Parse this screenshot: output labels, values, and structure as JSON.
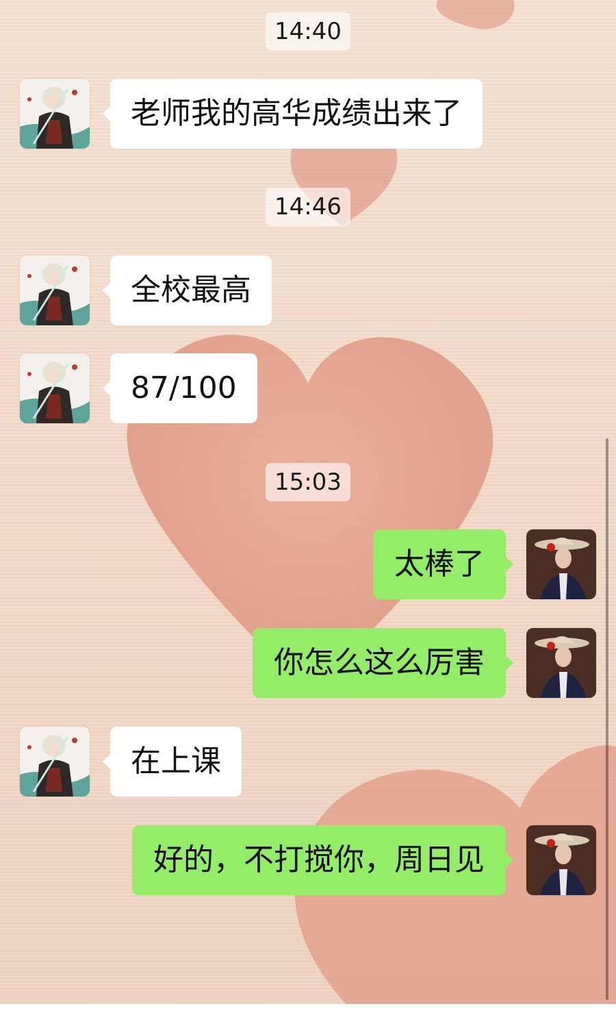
{
  "chat": {
    "timestamps": [
      "14:40",
      "14:46",
      "15:03"
    ],
    "messages": [
      {
        "side": "left",
        "text": "老师我的高华成绩出来了"
      },
      {
        "side": "left",
        "text": "全校最高"
      },
      {
        "side": "left",
        "text": "87/100"
      },
      {
        "side": "right",
        "text": "太棒了"
      },
      {
        "side": "right",
        "text": "你怎么这么厉害"
      },
      {
        "side": "left",
        "text": "在上课"
      },
      {
        "side": "right",
        "text": "好的，不打搅你，周日见"
      }
    ]
  },
  "colors": {
    "incoming_bubble": "#ffffff",
    "outgoing_bubble": "#95ec69",
    "background": "#f3dccb",
    "heart": "#e29a86"
  },
  "avatars": {
    "contact": "anime-swordsman-avatar",
    "self": "woman-in-hat-avatar"
  }
}
